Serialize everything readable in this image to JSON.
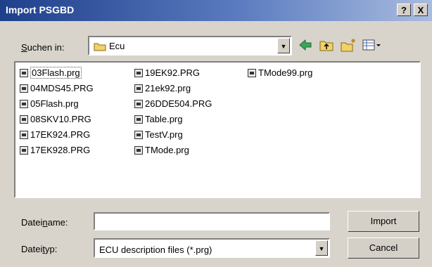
{
  "window": {
    "title": "Import PSGBD"
  },
  "titlebar": {
    "help_label": "?",
    "close_label": "X"
  },
  "lookin": {
    "label_prefix": "",
    "label_ul": "S",
    "label_rest": "uchen in:",
    "value": "Ecu"
  },
  "files": [
    {
      "name": "03Flash.prg",
      "selected": true
    },
    {
      "name": "04MDS45.PRG"
    },
    {
      "name": "05Flash.prg"
    },
    {
      "name": "08SKV10.PRG"
    },
    {
      "name": "17EK924.PRG"
    },
    {
      "name": "17EK928.PRG"
    },
    {
      "name": "19EK92.PRG"
    },
    {
      "name": "21ek92.prg"
    },
    {
      "name": "26DDE504.PRG"
    },
    {
      "name": "Table.prg"
    },
    {
      "name": "TestV.prg"
    },
    {
      "name": "TMode.prg"
    },
    {
      "name": "TMode99.prg"
    }
  ],
  "filename": {
    "label_pre": "Datei",
    "label_ul": "n",
    "label_post": "ame:",
    "value": ""
  },
  "filetype": {
    "label_pre": "Datei",
    "label_ul": "t",
    "label_post": "yp:",
    "value": "ECU description files (*.prg)"
  },
  "buttons": {
    "import": "Import",
    "cancel": "Cancel"
  },
  "icons": [
    "back-arrow-icon",
    "up-folder-icon",
    "new-folder-icon",
    "view-menu-icon",
    "folder-icon",
    "file-icon"
  ]
}
